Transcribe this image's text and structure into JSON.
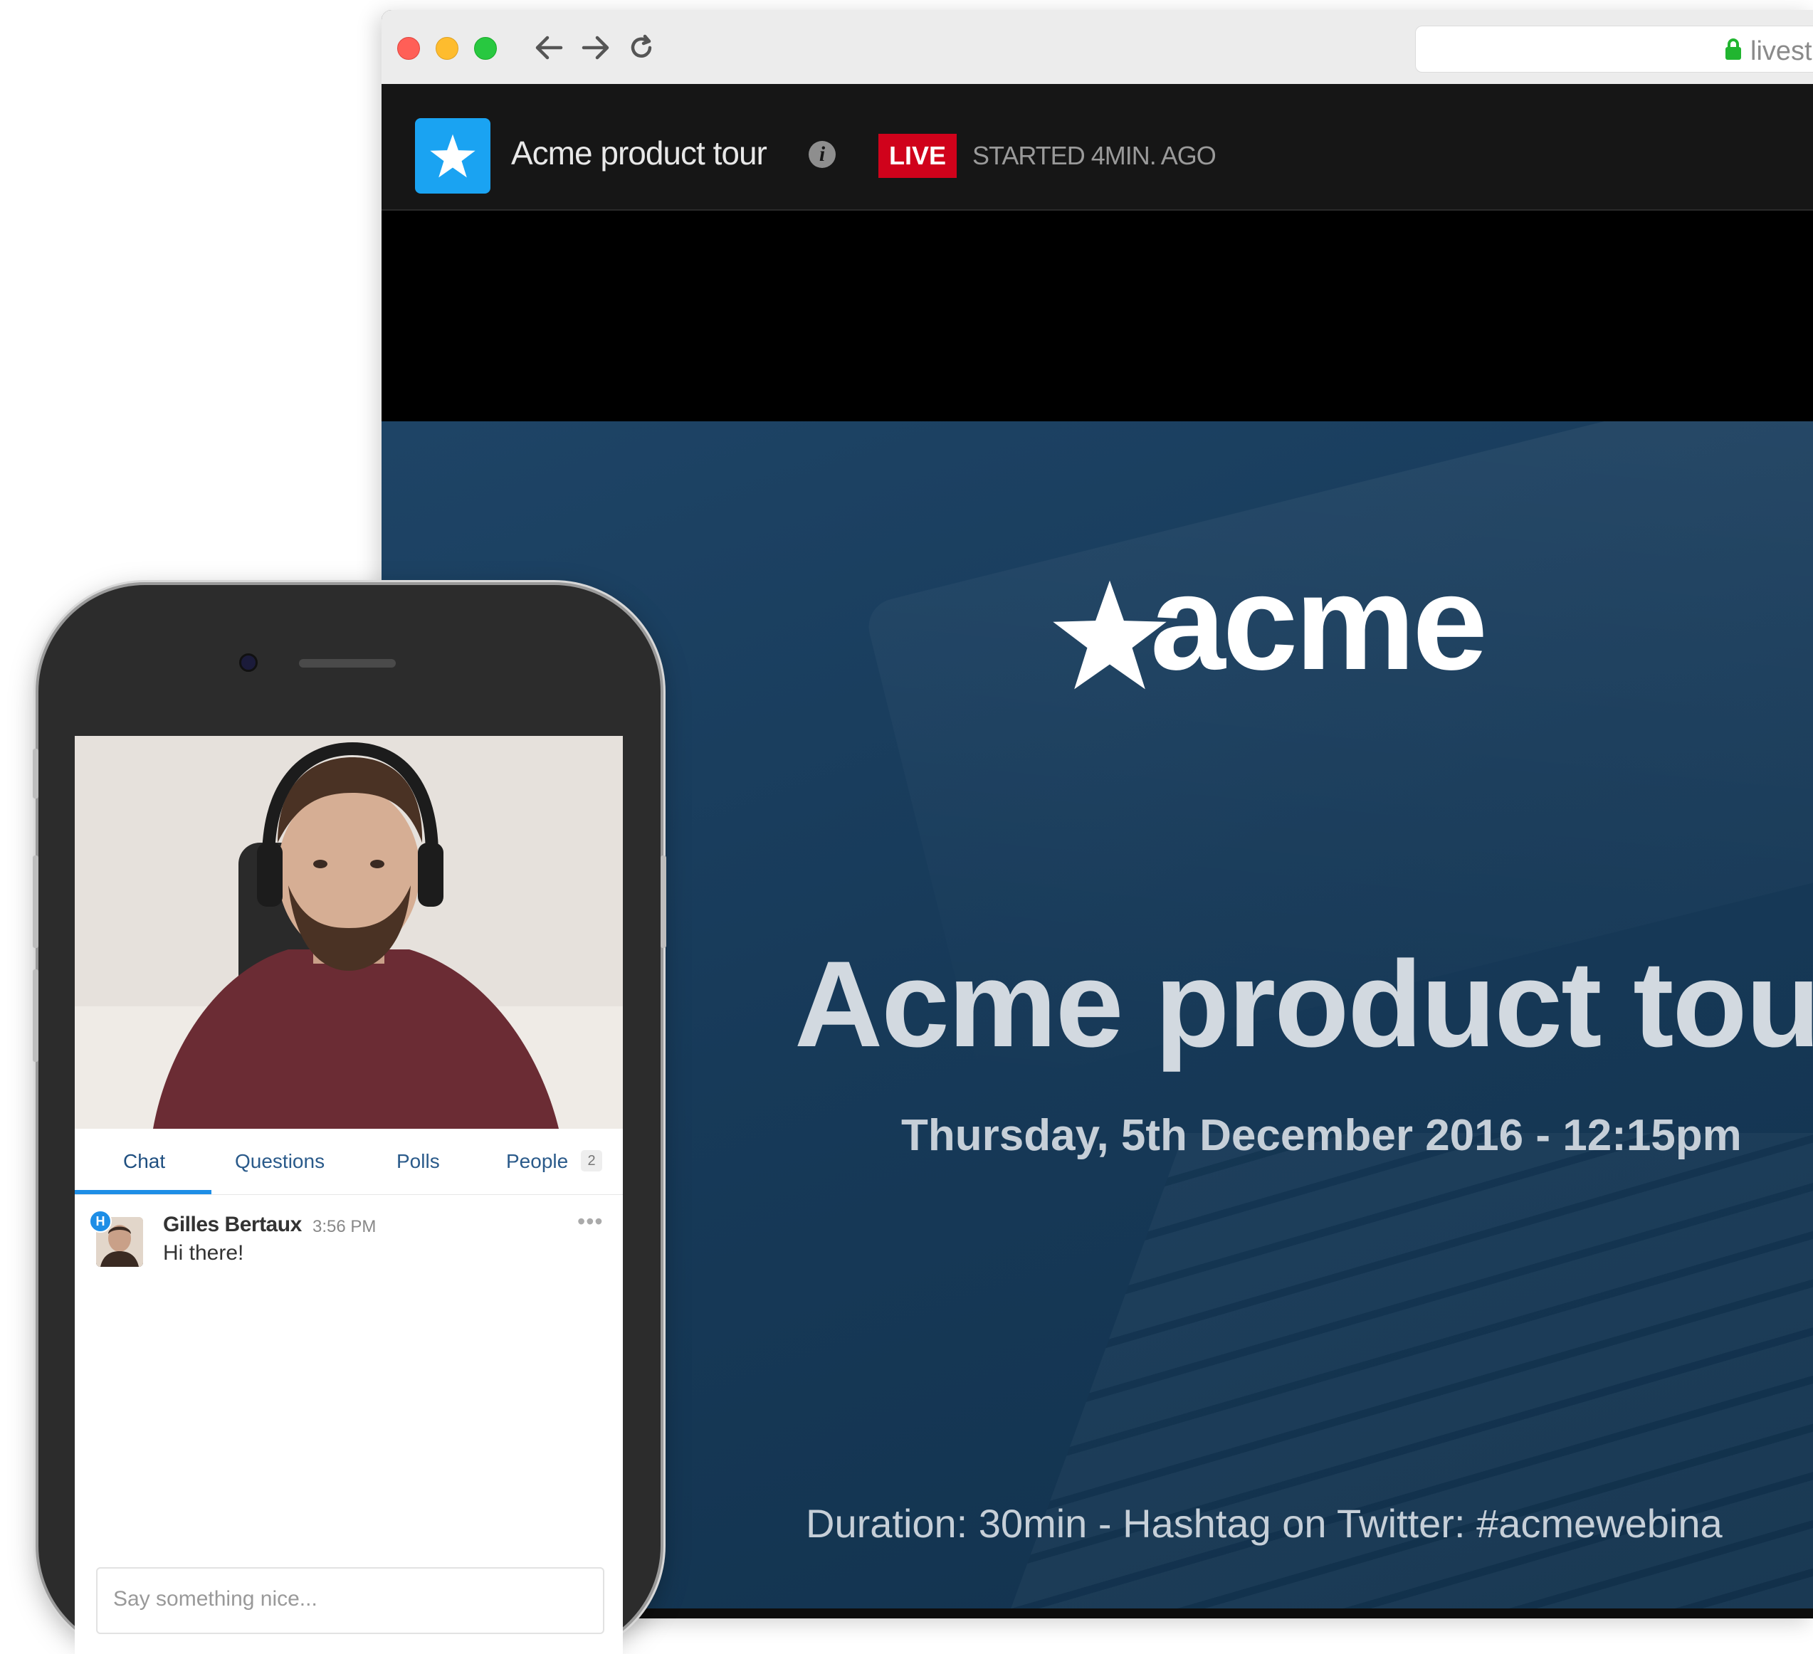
{
  "browser": {
    "address": {
      "url": "livest"
    },
    "app": {
      "title": "Acme product tour",
      "live_badge": "LIVE",
      "started": "STARTED 4MIN. AGO"
    },
    "slide": {
      "logo_text": "acme",
      "title": "Acme product tou",
      "date": "Thursday, 5th December 2016 - 12:15pm",
      "duration": "Duration: 30min - Hashtag on Twitter: #acmewebina"
    }
  },
  "phone": {
    "tabs": [
      {
        "label": "Chat",
        "active": true
      },
      {
        "label": "Questions"
      },
      {
        "label": "Polls"
      },
      {
        "label": "People",
        "count": "2"
      }
    ],
    "messages": [
      {
        "badge": "H",
        "author": "Gilles Bertaux",
        "time": "3:56 PM",
        "text": "Hi there!"
      }
    ],
    "input": {
      "placeholder": "Say something nice..."
    }
  },
  "colors": {
    "live_red": "#d0021b",
    "accent_blue": "#1aa3f2",
    "tab_underline": "#1e8ee6",
    "slide_bg": "#1a3d5c"
  },
  "icons": {
    "window_controls": [
      "close-dot",
      "minimize-dot",
      "maximize-dot"
    ],
    "nav": [
      "back-arrow-icon",
      "forward-arrow-icon",
      "reload-icon"
    ],
    "lock": "lock-icon",
    "logo": "star-icon",
    "info": "info-icon",
    "more": "more-icon"
  }
}
